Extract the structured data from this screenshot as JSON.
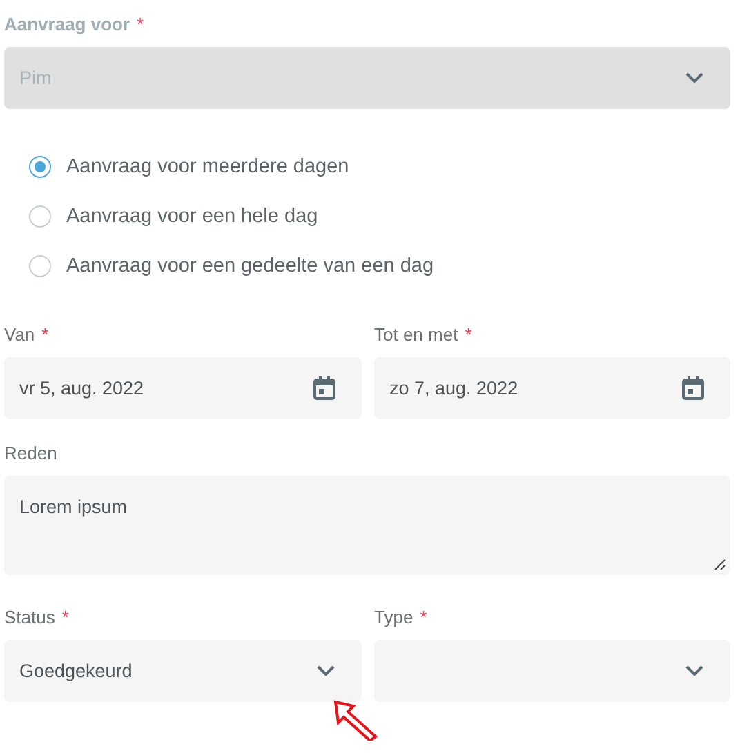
{
  "requester": {
    "label": "Aanvraag voor",
    "required_mark": "*",
    "value": "Pim",
    "disabled": true
  },
  "request_types": [
    {
      "label": "Aanvraag voor meerdere dagen",
      "selected": true
    },
    {
      "label": "Aanvraag voor een hele dag",
      "selected": false
    },
    {
      "label": "Aanvraag voor een gedeelte van een dag",
      "selected": false
    }
  ],
  "dates": [
    {
      "label": "Van",
      "required_mark": "*",
      "value": "vr 5, aug. 2022"
    },
    {
      "label": "Tot en met",
      "required_mark": "*",
      "value": "zo 7, aug. 2022"
    }
  ],
  "reason": {
    "label": "Reden",
    "value": "Lorem ipsum"
  },
  "selects": [
    {
      "label": "Status",
      "required_mark": "*",
      "value": "Goedgekeurd"
    },
    {
      "label": "Type",
      "required_mark": "*"
    }
  ],
  "annotation": {
    "kind": "arrow"
  }
}
